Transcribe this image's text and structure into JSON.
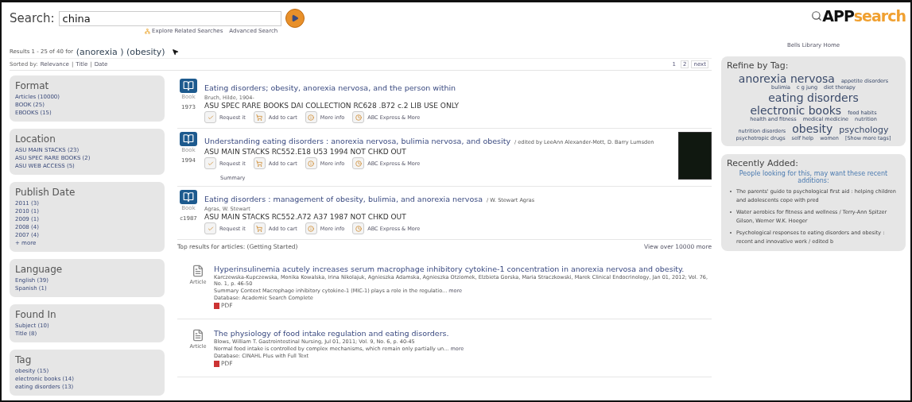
{
  "search": {
    "label": "Search:",
    "value": "china",
    "links": [
      "Explore Related Searches",
      "Advanced Search"
    ]
  },
  "logo": {
    "strong": "APP",
    "rest": "search"
  },
  "home_link": "Bells Library Home",
  "results_summary": {
    "prefix": "Results 1 - 25 of 40 for",
    "query": "(anorexia ) (obesity)"
  },
  "sort": {
    "label": "Sorted by:",
    "options": [
      "Relevance",
      "Title",
      "Date"
    ],
    "separator": "|"
  },
  "pages": [
    {
      "label": "1",
      "selected": true
    },
    {
      "label": "2",
      "selected": false
    },
    {
      "label": "next",
      "selected": false
    }
  ],
  "facets": [
    {
      "title": "Format",
      "items": [
        "Articles (10000)",
        "BOOK (25)",
        "EBOOKS (15)"
      ]
    },
    {
      "title": "Location",
      "items": [
        "ASU MAIN STACKS (23)",
        "ASU SPEC RARE BOOKS (2)",
        "ASU WEB ACCESS (5)"
      ]
    },
    {
      "title": "Publish Date",
      "items": [
        "2011 (3)",
        "2010 (1)",
        "2009 (1)",
        "2008 (4)",
        "2007 (4)",
        "+ more"
      ]
    },
    {
      "title": "Language",
      "items": [
        "English (39)",
        "Spanish (1)"
      ]
    },
    {
      "title": "Found In",
      "items": [
        "Subject (10)",
        "Title (8)"
      ]
    },
    {
      "title": "Tag",
      "items": [
        "obesity (15)",
        "electronic books (14)",
        "eating disorders (13)"
      ]
    }
  ],
  "books": [
    {
      "type": "Book",
      "year": "1973",
      "title": "Eating disorders; obesity, anorexia nervosa, and the person within",
      "author": "Bruch, Hilde, 1904-",
      "holding": "ASU SPEC RARE BOOKS DAI COLLECTION RC628 .B72  c.2 LIB USE ONLY",
      "actions": [
        {
          "kind": "request",
          "label": "Request it"
        },
        {
          "kind": "cart",
          "label": "Add to cart"
        },
        {
          "kind": "info",
          "label": "More info"
        },
        {
          "kind": "express",
          "label": "ABC Express & More"
        }
      ],
      "cover": false
    },
    {
      "type": "Book",
      "year": "1994",
      "title": "Understanding eating disorders : anorexia nervosa, bulimia nervosa, and obesity",
      "responsibility": "/ edited by LeeAnn Alexander-Mott, D. Barry Lumsden",
      "holding": "ASU MAIN STACKS RC552.E18 U53 1994   NOT CHKD OUT",
      "actions": [
        {
          "kind": "request",
          "label": "Request it"
        },
        {
          "kind": "cart",
          "label": "Add to cart"
        },
        {
          "kind": "info",
          "label": "More info"
        },
        {
          "kind": "express",
          "label": "ABC Express & More"
        }
      ],
      "cover": true,
      "summary": "Summary"
    },
    {
      "type": "Book",
      "year": "c1987",
      "title": "Eating disorders : management of obesity, bulimia, and anorexia nervosa",
      "responsibility": "/ W. Stewart Agras",
      "author": "Agras, W. Stewart",
      "holding": "ASU MAIN STACKS RC552.A72 A37 1987   NOT CHKD OUT",
      "actions": [
        {
          "kind": "request",
          "label": "Request it"
        },
        {
          "kind": "cart",
          "label": "Add to cart"
        },
        {
          "kind": "info",
          "label": "More info"
        },
        {
          "kind": "express",
          "label": "ABC Express & More"
        }
      ],
      "cover": false
    }
  ],
  "articles_header": {
    "title": "Top results for articles: (Getting Started)",
    "more": "View over 10000 more"
  },
  "articles": [
    {
      "type": "Article",
      "title": "Hyperinsulinemia acutely increases serum macrophage inhibitory cytokine-1 concentration in anorexia nervosa and obesity.",
      "citation": "Karczewska-Kupczewska, Monika Kowalska, Irina Nikolajuk, Agnieszka Adamska, Agnieszka Otziomek, Elzbieta Gorska, Maria Straczkowski, Marek Clinical Endocrinology, Jan 01, 2012; Vol. 76, No. 1, p. 46-50",
      "abstract": "Summary Context Macrophage inhibitory cytokine-1 (MIC-1) plays a role in the regulatio...",
      "more": "more",
      "database": "Database: Academic Search Complete",
      "pdf": "PDF"
    },
    {
      "type": "Article",
      "title": "The physiology of food intake regulation and eating disorders.",
      "citation": "Blows, William T. Gastrointestinal Nursing, Jul 01, 2011; Vol. 9, No. 6, p. 40-45",
      "abstract": "Normal food intake is controlled by complex mechanisms, which remain only partially un...",
      "more": "more",
      "database": "Database: CINAHL Plus with Full Text",
      "pdf": "PDF"
    }
  ],
  "tag_cloud": {
    "title": "Refine by Tag:",
    "tags": [
      {
        "label": "anorexia nervosa",
        "kind": "large"
      },
      {
        "label": "appetite disorders",
        "kind": "small"
      },
      {
        "label": "bulimia",
        "kind": "small"
      },
      {
        "label": "c g jung",
        "kind": "small"
      },
      {
        "label": "diet therapy",
        "kind": "small"
      },
      {
        "label": "eating disorders",
        "kind": "large"
      },
      {
        "label": "electronic books",
        "kind": "large"
      },
      {
        "label": "food habits",
        "kind": "small"
      },
      {
        "label": "health and fitness",
        "kind": "small"
      },
      {
        "label": "medical medicine",
        "kind": "small"
      },
      {
        "label": "nutrition",
        "kind": "small"
      },
      {
        "label": "nutrition disorders",
        "kind": "small"
      },
      {
        "label": "obesity",
        "kind": "large"
      },
      {
        "label": "psychology",
        "kind": "medium"
      },
      {
        "label": "psychotropic drugs",
        "kind": "small"
      },
      {
        "label": "self help",
        "kind": "small"
      },
      {
        "label": "women",
        "kind": "small"
      }
    ],
    "more": "[Show more tags]"
  },
  "recent": {
    "title": "Recently Added:",
    "intro": "People looking for this, may want these recent additions:",
    "items": [
      "The parents' guide to psychological first aid : helping children and adolescents cope with pred",
      "Water aerobics for fitness and wellness / Terry-Ann Spitzer Gilson, Werner W.K. Hoeger",
      "Psychological responses to eating disorders and obesity : recent and innovative work / edited b"
    ]
  }
}
